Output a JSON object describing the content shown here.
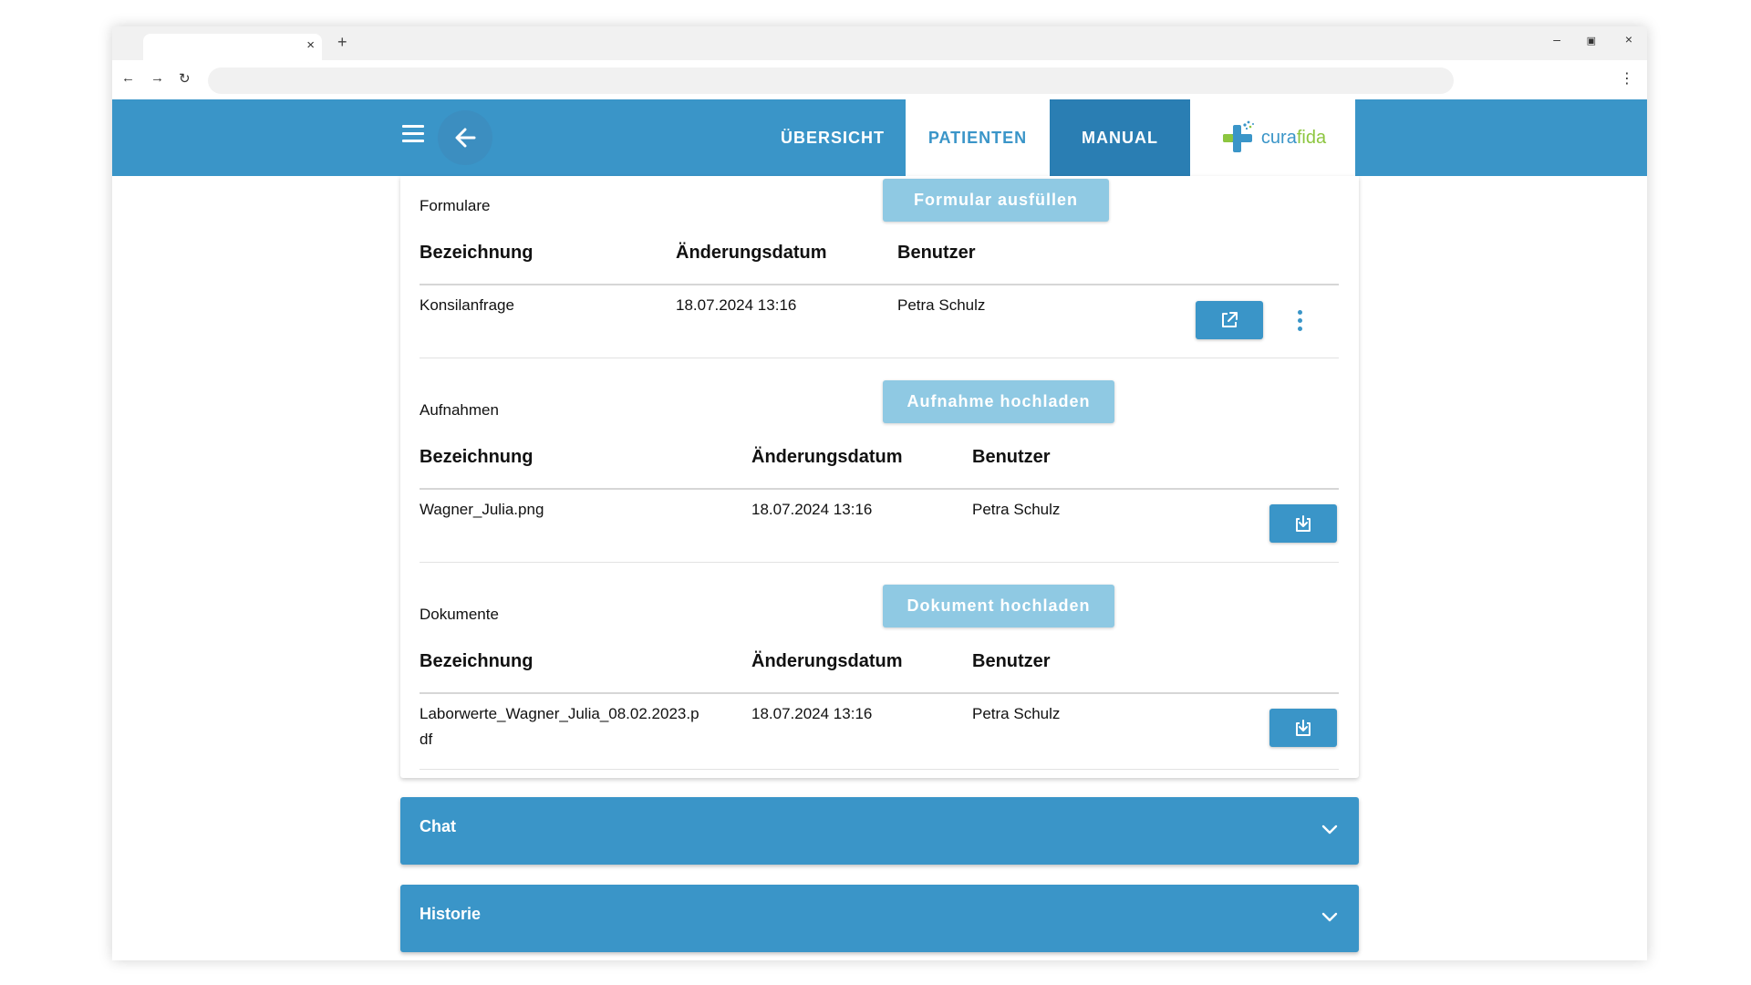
{
  "browser": {
    "tab_close": "×",
    "new_tab": "+",
    "win_min": "–",
    "win_max": "▣",
    "win_close": "×",
    "nav_back": "←",
    "nav_forward": "→",
    "reload": "↻",
    "menu": "⋮",
    "url": ""
  },
  "header": {
    "tabs": {
      "overview": "ÜBERSICHT",
      "patients": "PATIENTEN",
      "manual": "MANUAL"
    },
    "logo": {
      "part1": "cura",
      "part2": "fida"
    },
    "active_tab": "patients",
    "colors": {
      "primary": "#3a95c8",
      "manual_tab": "#2a7eb3",
      "logo_green": "#8dc63f"
    }
  },
  "forms": {
    "title": "Formulare",
    "button": "Formular ausfüllen",
    "columns": [
      "Bezeichnung",
      "Änderungsdatum",
      "Benutzer"
    ],
    "rows": [
      {
        "name": "Konsilanfrage",
        "date": "18.07.2024 13:16",
        "user": "Petra Schulz",
        "actions": [
          "external-link-icon",
          "more-vert-icon"
        ]
      }
    ]
  },
  "recordings": {
    "title": "Aufnahmen",
    "button": "Aufnahme hochladen",
    "columns": [
      "Bezeichnung",
      "Änderungsdatum",
      "Benutzer"
    ],
    "rows": [
      {
        "name": "Wagner_Julia.png",
        "date": "18.07.2024 13:16",
        "user": "Petra Schulz",
        "actions": [
          "download-icon"
        ]
      }
    ]
  },
  "documents": {
    "title": "Dokumente",
    "button": "Dokument hochladen",
    "columns": [
      "Bezeichnung",
      "Änderungsdatum",
      "Benutzer"
    ],
    "rows": [
      {
        "name": "Laborwerte_Wagner_Julia_08.02.2023.p",
        "name_cont": "df",
        "date": "18.07.2024 13:16",
        "user": "Petra Schulz",
        "actions": [
          "download-icon"
        ]
      }
    ]
  },
  "panels": {
    "chat": "Chat",
    "history": "Historie"
  }
}
